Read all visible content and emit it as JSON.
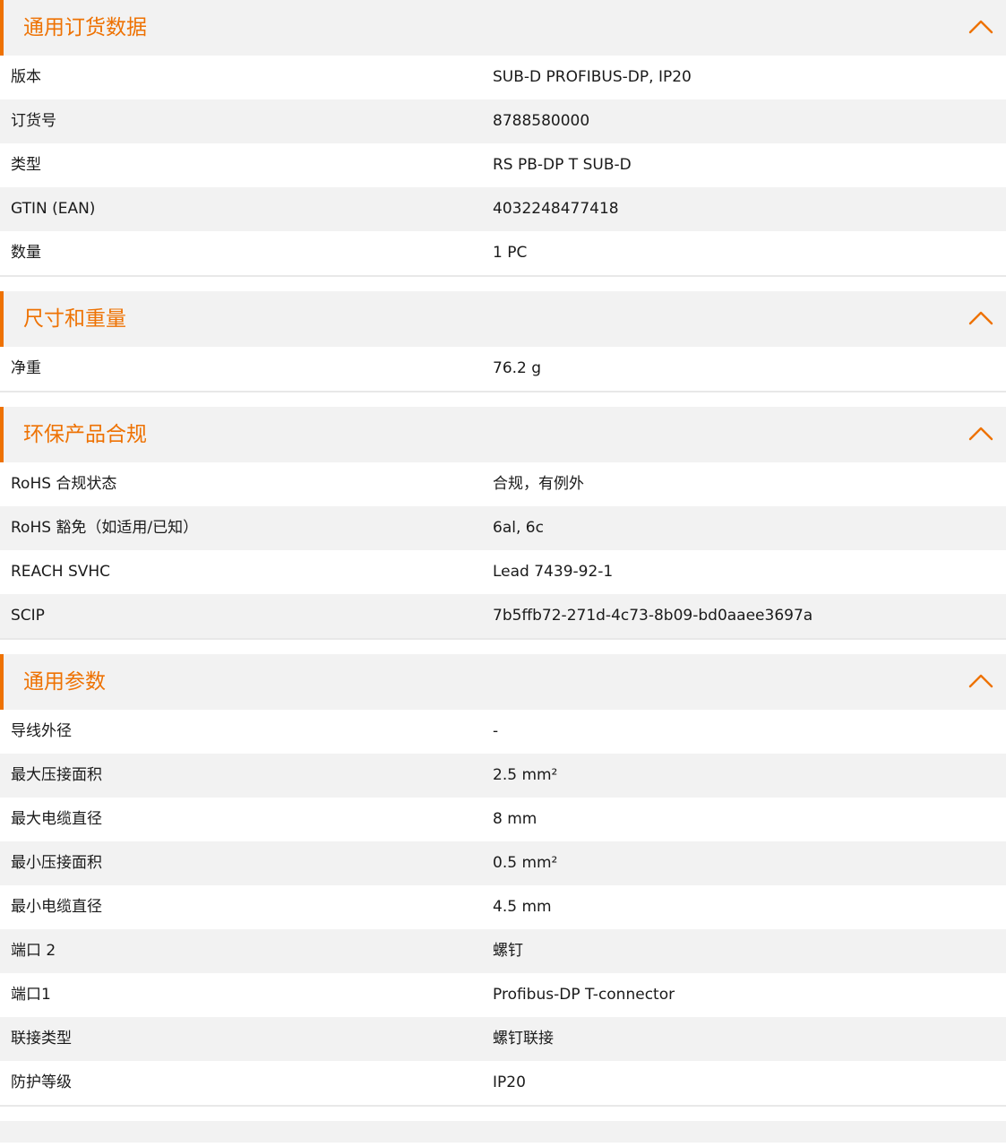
{
  "accent_color": "#ee7203",
  "sections": [
    {
      "title": "通用订货数据",
      "collapse_icon": "chevron-up-icon",
      "rows": [
        {
          "label": "版本",
          "value": "SUB-D PROFIBUS-DP, IP20"
        },
        {
          "label": "订货号",
          "value": "8788580000"
        },
        {
          "label": "类型",
          "value": "RS PB-DP T SUB-D"
        },
        {
          "label": "GTIN (EAN)",
          "value": "4032248477418"
        },
        {
          "label": "数量",
          "value": "1  PC"
        }
      ]
    },
    {
      "title": "尺寸和重量",
      "collapse_icon": "chevron-up-icon",
      "rows": [
        {
          "label": "净重",
          "value": "76.2  g"
        }
      ]
    },
    {
      "title": "环保产品合规",
      "collapse_icon": "chevron-up-icon",
      "rows": [
        {
          "label": "RoHS 合规状态",
          "value": "合规，有例外"
        },
        {
          "label": "RoHS 豁免（如适用/已知）",
          "value": "6al, 6c"
        },
        {
          "label": "REACH SVHC",
          "value": "Lead 7439-92-1"
        },
        {
          "label": "SCIP",
          "value": "7b5ffb72-271d-4c73-8b09-bd0aaee3697a"
        }
      ]
    },
    {
      "title": "通用参数",
      "collapse_icon": "chevron-up-icon",
      "rows": [
        {
          "label": "导线外径",
          "value": "-"
        },
        {
          "label": "最大压接面积",
          "value": "2.5  mm²"
        },
        {
          "label": "最大电缆直径",
          "value": "8  mm"
        },
        {
          "label": "最小压接面积",
          "value": "0.5  mm²"
        },
        {
          "label": "最小电缆直径",
          "value": "4.5  mm"
        },
        {
          "label": "端口 2",
          "value": "螺钉"
        },
        {
          "label": "端口1",
          "value": "Profibus-DP T-connector"
        },
        {
          "label": "联接类型",
          "value": "螺钉联接"
        },
        {
          "label": "防护等级",
          "value": "IP20"
        }
      ]
    }
  ]
}
